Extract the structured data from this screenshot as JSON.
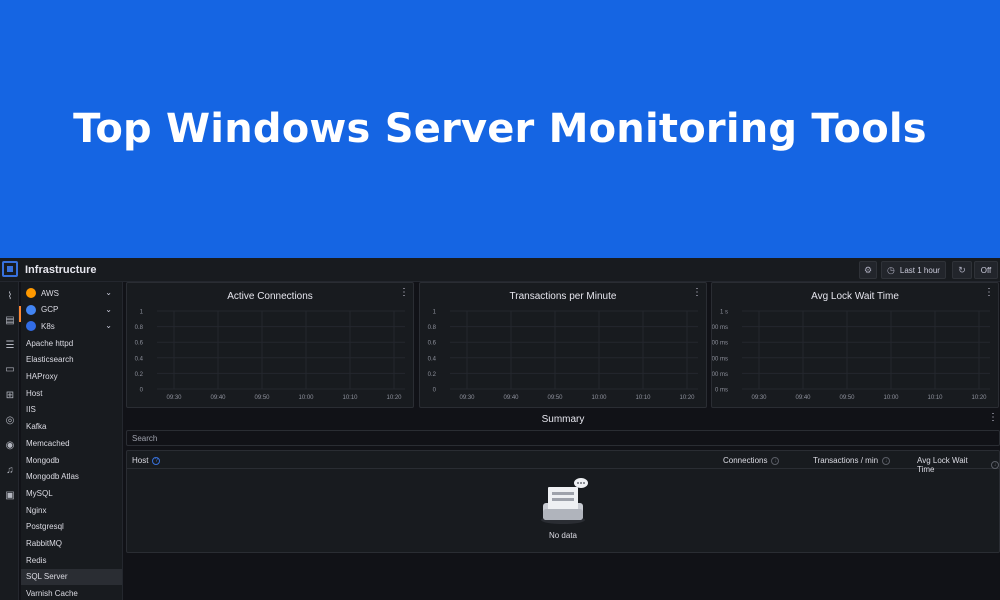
{
  "banner": {
    "title": "Top Windows Server Monitoring Tools"
  },
  "app": {
    "title": "Infrastructure",
    "toolbar": {
      "time_range": "Last 1 hour",
      "refresh": "Off"
    }
  },
  "sidebar": {
    "items": [
      {
        "label": "AWS",
        "icon": "aws-icon",
        "color": "#ff9900",
        "expandable": true
      },
      {
        "label": "GCP",
        "icon": "gcp-icon",
        "color": "#4285f4",
        "expandable": true
      },
      {
        "label": "K8s",
        "icon": "k8s-icon",
        "color": "#326ce5",
        "expandable": true
      },
      {
        "label": "Apache httpd"
      },
      {
        "label": "Elasticsearch"
      },
      {
        "label": "HAProxy"
      },
      {
        "label": "Host"
      },
      {
        "label": "IIS"
      },
      {
        "label": "Kafka"
      },
      {
        "label": "Memcached"
      },
      {
        "label": "Mongodb"
      },
      {
        "label": "Mongodb Atlas"
      },
      {
        "label": "MySQL"
      },
      {
        "label": "Nginx"
      },
      {
        "label": "Postgresql"
      },
      {
        "label": "RabbitMQ"
      },
      {
        "label": "Redis"
      },
      {
        "label": "SQL Server",
        "selected": true
      },
      {
        "label": "Varnish Cache"
      }
    ]
  },
  "panels": [
    {
      "title": "Active Connections",
      "yticks": [
        "1",
        "0.8",
        "0.6",
        "0.4",
        "0.2",
        "0"
      ],
      "xticks": [
        "09:30",
        "09:40",
        "09:50",
        "10:00",
        "10:10",
        "10:20"
      ]
    },
    {
      "title": "Transactions per Minute",
      "yticks": [
        "1",
        "0.8",
        "0.6",
        "0.4",
        "0.2",
        "0"
      ],
      "xticks": [
        "09:30",
        "09:40",
        "09:50",
        "10:00",
        "10:10",
        "10:20"
      ]
    },
    {
      "title": "Avg Lock Wait Time",
      "yticks": [
        "1 s",
        "800 ms",
        "600 ms",
        "400 ms",
        "200 ms",
        "0 ms"
      ],
      "xticks": [
        "09:30",
        "09:40",
        "09:50",
        "10:00",
        "10:10",
        "10:20"
      ]
    }
  ],
  "summary": {
    "title": "Summary",
    "search_placeholder": "Search",
    "columns": {
      "host": "Host",
      "connections": "Connections",
      "transactions": "Transactions / min",
      "lock_wait": "Avg Lock Wait Time"
    },
    "empty_text": "No data"
  },
  "colors": {
    "banner": "#1565e3",
    "accent": "#3871dc",
    "active_marker": "#ff8833"
  }
}
